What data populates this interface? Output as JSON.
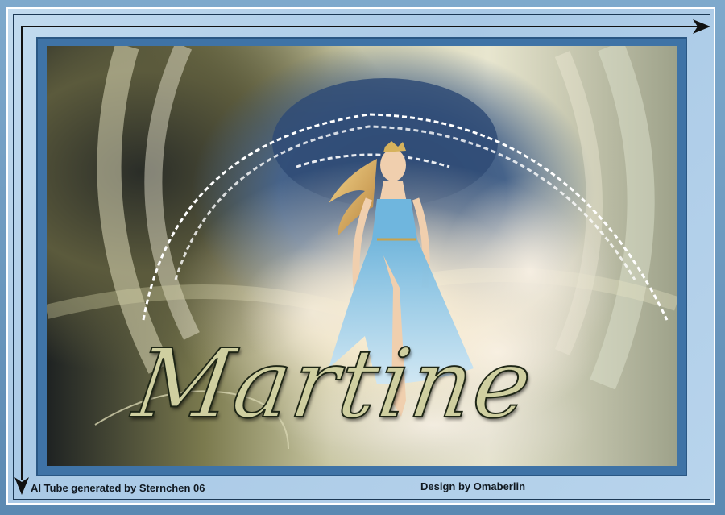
{
  "artwork": {
    "signature_text": "Martine",
    "credit_left": "AI Tube generated by Sternchen 06",
    "credit_right": "Design by Omaberlin"
  },
  "colors": {
    "frame_blue": "#3f73a6",
    "light_blue": "#b8d4ec",
    "dress_blue": "#7fc2e4",
    "text_dark": "#101820"
  },
  "icons": {
    "top_arrow": "arrow-right-icon",
    "left_arrow": "arrow-down-icon"
  }
}
